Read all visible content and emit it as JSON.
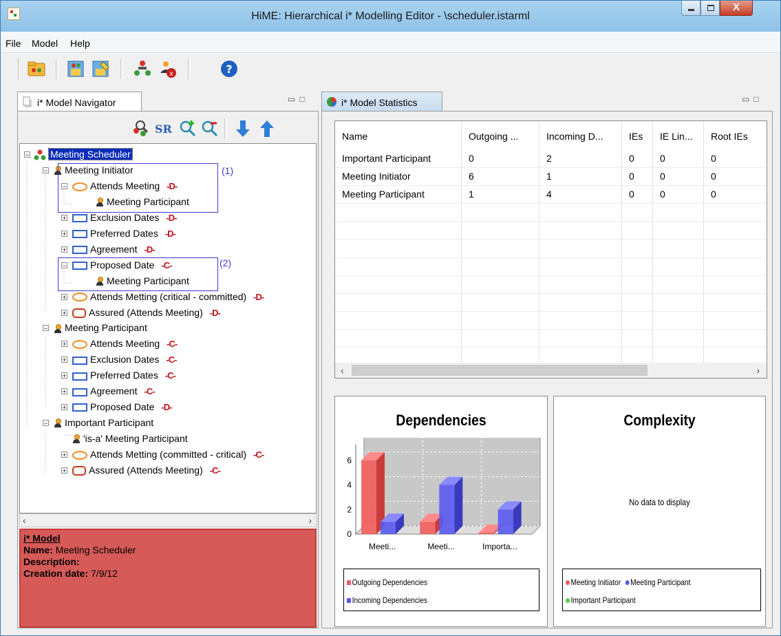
{
  "window": {
    "title": "HiME: Hierarchical i* Modelling Editor - \\scheduler.istarml",
    "close_glyph": "X"
  },
  "menu": [
    "File",
    "Model",
    "Help"
  ],
  "navigator": {
    "tab_label": "i* Model Navigator",
    "tree": [
      {
        "label": "Meeting Scheduler",
        "type": "model",
        "level": 0,
        "selected": true
      },
      {
        "label": "Meeting Initiator",
        "type": "actor",
        "level": 1
      },
      {
        "label": "Attends Meeting",
        "type": "goal",
        "level": 2,
        "dep": "out"
      },
      {
        "label": "Meeting Participant",
        "type": "actor",
        "level": 3
      },
      {
        "label": "Exclusion Dates",
        "type": "resource",
        "level": 2,
        "dep": "out"
      },
      {
        "label": "Preferred Dates",
        "type": "resource",
        "level": 2,
        "dep": "out"
      },
      {
        "label": "Agreement",
        "type": "resource",
        "level": 2,
        "dep": "out"
      },
      {
        "label": "Proposed Date",
        "type": "resource",
        "level": 2,
        "dep": "in"
      },
      {
        "label": "Meeting Participant",
        "type": "actor",
        "level": 3
      },
      {
        "label": "Attends Metting  (critical - committed)",
        "type": "goal",
        "level": 2,
        "dep": "out"
      },
      {
        "label": "Assured (Attends Meeting)",
        "type": "softgoal",
        "level": 2,
        "dep": "out"
      },
      {
        "label": "Meeting Participant",
        "type": "actor",
        "level": 1
      },
      {
        "label": "Attends Meeting",
        "type": "goal",
        "level": 2,
        "dep": "in"
      },
      {
        "label": "Exclusion Dates",
        "type": "resource",
        "level": 2,
        "dep": "in"
      },
      {
        "label": "Preferred Dates",
        "type": "resource",
        "level": 2,
        "dep": "in"
      },
      {
        "label": "Agreement",
        "type": "resource",
        "level": 2,
        "dep": "in"
      },
      {
        "label": "Proposed Date",
        "type": "resource",
        "level": 2,
        "dep": "out"
      },
      {
        "label": "Important Participant",
        "type": "actor",
        "level": 1
      },
      {
        "label": "'is-a' Meeting Participant",
        "type": "actor",
        "level": 2
      },
      {
        "label": "Attends Metting  (committed - critical)",
        "type": "goal",
        "level": 2,
        "dep": "in"
      },
      {
        "label": "Assured (Attends Meeting)",
        "type": "softgoal",
        "level": 2,
        "dep": "in"
      }
    ],
    "annotations": [
      "(1)",
      "(2)"
    ],
    "dep_out_glyph": "-D-",
    "dep_in_glyph": "-C-"
  },
  "properties": {
    "title": "i* Model",
    "name_label": "Name:",
    "name_value": "Meeting Scheduler",
    "description_label": "Description:",
    "description_value": "",
    "creation_label": "Creation date:",
    "creation_value": "7/9/12"
  },
  "stats": {
    "tab_label": "i* Model Statistics",
    "columns": [
      "Name",
      "Outgoing ...",
      "Incoming D...",
      "IEs",
      "IE Lin...",
      "Root IEs"
    ],
    "rows": [
      [
        "Important Participant",
        "0",
        "2",
        "0",
        "0",
        "0"
      ],
      [
        "Meeting Initiator",
        "6",
        "1",
        "0",
        "0",
        "0"
      ],
      [
        "Meeting Participant",
        "1",
        "4",
        "0",
        "0",
        "0"
      ]
    ]
  },
  "chart_data": [
    {
      "type": "bar",
      "title": "Dependencies",
      "categories": [
        "Meeti...",
        "Meeti...",
        "Importa..."
      ],
      "series": [
        {
          "name": "Outgoing Dependencies",
          "values": [
            6,
            1,
            0
          ],
          "color": "#f25d5d"
        },
        {
          "name": "Incoming Dependencies",
          "values": [
            1,
            4,
            2
          ],
          "color": "#5a5af0"
        }
      ],
      "ylim": [
        0,
        7
      ],
      "yticks": [
        "0",
        "2",
        "4",
        "6"
      ],
      "grid": true,
      "legend": "bottom"
    },
    {
      "type": "pie",
      "title": "Complexity",
      "message": "No data to display",
      "legend_entries": [
        {
          "name": "Meeting Initiator",
          "color": "#f25d5d"
        },
        {
          "name": "Meeting Participant",
          "color": "#5a5af0"
        },
        {
          "name": "Important Participant",
          "color": "#4fd44f"
        }
      ],
      "legend": "bottom"
    }
  ]
}
